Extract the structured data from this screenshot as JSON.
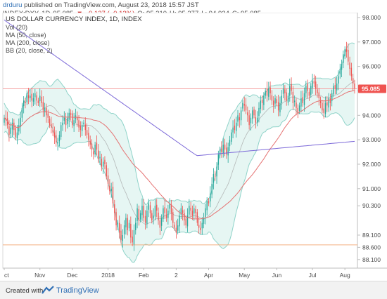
{
  "header": {
    "author": "drduru",
    "published": "published on TradingView.com, August 23, 2018 15:57 JST",
    "symbol": "INDEX:DXY, 1D",
    "quote": "95.085",
    "change": "▼ −0.127 (−0.13%)",
    "open": "O: 95.210",
    "high": "H: 95.377",
    "low": "L: 94.934",
    "close": "C: 95.085"
  },
  "footer": {
    "created_with": "Created with",
    "brand": "TradingView"
  },
  "colors": {
    "up": "#26a69a",
    "down": "#ef5350",
    "ma50": "#e57373",
    "ma200": "#7b68d8",
    "band": "#8fd3c9",
    "band_fill": "#e6f6f3",
    "price_line": "#f5a3a3",
    "price_tag": "#ef5350",
    "horizontal_line": "#f4b183"
  },
  "chart_data": {
    "type": "candlestick",
    "title": "US DOLLAR CURRENCY INDEX, 1D, INDEX",
    "legend": [
      "Vol (20)",
      "MA (50, close)",
      "MA (200, close)",
      "BB (20, close, 2)"
    ],
    "current_price_label": "95.085",
    "reference_line": 88.7,
    "ylim": [
      87.75,
      98.2
    ],
    "y_ticks": [
      "98.000",
      "97.000",
      "96.000",
      "95.000",
      "94.000",
      "93.000",
      "92.000",
      "91.000",
      "90.300",
      "89.100",
      "88.600",
      "88.100"
    ],
    "y_tick_values": [
      98.0,
      97.0,
      96.0,
      95.0,
      94.0,
      93.0,
      92.0,
      91.0,
      90.3,
      89.1,
      88.6,
      88.1
    ],
    "x_labels": [
      "ct",
      "Nov",
      "Dec",
      "2018",
      "Feb",
      "2",
      "Apr",
      "May",
      "Jun",
      "Jul",
      "Aug"
    ],
    "x_label_index": [
      0,
      22,
      42,
      64,
      86,
      106,
      126,
      148,
      168,
      190,
      210
    ],
    "closes": [
      93.9,
      93.8,
      93.6,
      93.2,
      93.5,
      93.7,
      93.4,
      93.1,
      93.3,
      93.6,
      93.9,
      94.3,
      94.6,
      94.5,
      94.9,
      94.7,
      94.8,
      94.6,
      94.7,
      94.9,
      94.6,
      94.5,
      94.8,
      94.5,
      94.2,
      94.3,
      94.0,
      93.9,
      93.6,
      93.5,
      93.3,
      93.1,
      92.9,
      92.9,
      93.2,
      93.6,
      93.7,
      93.9,
      93.6,
      93.9,
      94.1,
      94.0,
      93.6,
      93.8,
      94.0,
      93.8,
      93.5,
      93.4,
      93.6,
      93.7,
      93.4,
      93.2,
      93.0,
      92.8,
      92.6,
      92.4,
      92.8,
      92.6,
      92.2,
      92.3,
      91.9,
      92.1,
      92.0,
      91.5,
      91.2,
      90.9,
      91.0,
      90.4,
      90.0,
      89.5,
      89.6,
      89.2,
      88.9,
      89.1,
      89.5,
      89.8,
      89.3,
      89.6,
      89.0,
      88.8,
      89.3,
      89.6,
      90.2,
      89.7,
      90.0,
      90.3,
      89.8,
      89.6,
      90.1,
      90.4,
      90.0,
      89.7,
      89.9,
      90.3,
      90.1,
      89.7,
      89.4,
      89.8,
      90.2,
      90.0,
      89.8,
      90.1,
      90.4,
      90.0,
      89.6,
      89.4,
      89.2,
      89.5,
      89.9,
      90.2,
      90.0,
      89.7,
      89.5,
      89.9,
      90.3,
      90.1,
      89.9,
      90.2,
      90.0,
      89.6,
      89.4,
      89.3,
      89.6,
      89.8,
      90.2,
      90.5,
      90.4,
      90.8,
      91.2,
      91.6,
      91.5,
      91.9,
      92.4,
      92.6,
      92.5,
      92.8,
      92.6,
      92.4,
      92.7,
      93.0,
      93.3,
      93.5,
      93.4,
      93.7,
      94.0,
      93.8,
      94.2,
      94.5,
      94.4,
      94.2,
      94.0,
      93.6,
      93.9,
      94.2,
      94.0,
      93.7,
      93.9,
      94.3,
      94.6,
      94.5,
      94.8,
      95.0,
      94.8,
      95.1,
      94.9,
      94.6,
      94.4,
      94.7,
      94.5,
      94.2,
      94.5,
      94.8,
      95.1,
      94.9,
      94.6,
      94.8,
      95.2,
      95.0,
      94.5,
      94.6,
      94.3,
      94.1,
      94.4,
      94.7,
      94.5,
      94.9,
      95.2,
      95.0,
      94.8,
      95.2,
      95.4,
      95.3,
      95.1,
      94.9,
      94.7,
      94.5,
      94.2,
      94.1,
      94.5,
      94.4,
      94.7,
      94.5,
      94.9,
      95.2,
      95.1,
      95.3,
      95.6,
      95.9,
      96.1,
      96.5,
      96.7,
      96.6,
      96.2,
      95.9,
      95.6,
      95.3,
      95.1
    ]
  }
}
